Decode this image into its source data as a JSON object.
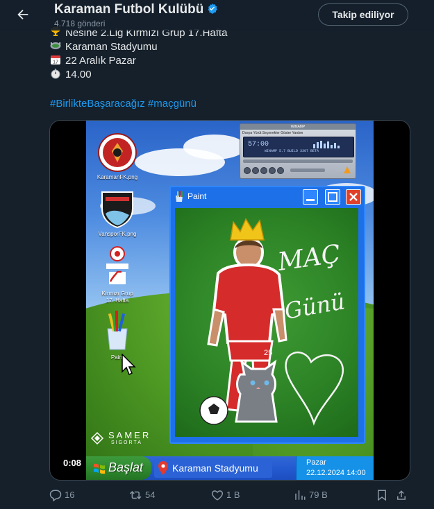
{
  "header": {
    "name": "Karaman Futbol Kulübü",
    "post_count": "4.718 gönderi",
    "follow_label": "Takip ediliyor"
  },
  "post": {
    "lines": [
      "Nesine 2.Lig Kırmızı Grup 17.Hafta",
      "Karaman Stadyumu",
      "22 Aralık Pazar",
      "14.00"
    ],
    "line_icons": [
      "trophy-icon",
      "stadium-icon",
      "calendar-icon",
      "stopwatch-icon"
    ],
    "hashtags": [
      "#BirlikteBaşaracağız",
      "#maçgünü"
    ]
  },
  "media": {
    "desktop_icons": {
      "karaman": "KaramanFK.png",
      "vanspor": "VansporFK.png",
      "nesine_1": "Kırmızı Grup",
      "nesine_2": "17. Hafta",
      "paint": "Paint"
    },
    "winamp": {
      "menu": "Dosya  Yürüt  Seçenekler  Göster  Yardım",
      "time": "57:00",
      "scroll": "WINAMP 5.7 BUILD 3307 BETA"
    },
    "paint_window": {
      "title": "Paint",
      "drawing_text_1": "MAÇ",
      "drawing_text_2": "Günü",
      "jersey_number": "25"
    },
    "taskbar": {
      "start_label": "Başlat",
      "task_label": "Karaman Stadyumu",
      "tray_day": "Pazar",
      "tray_datetime": "22.12.2024 14:00"
    },
    "sponsor": {
      "name": "SAMER",
      "sub": "SIGORTA"
    },
    "video_time": "0:08"
  },
  "actions": {
    "replies": "16",
    "reposts": "54",
    "likes": "1 B",
    "views": "79 B"
  },
  "colors": {
    "background": "#15202b",
    "link": "#1d9bf0",
    "muted": "#8b98a5",
    "verified": "#1d9bf0"
  }
}
